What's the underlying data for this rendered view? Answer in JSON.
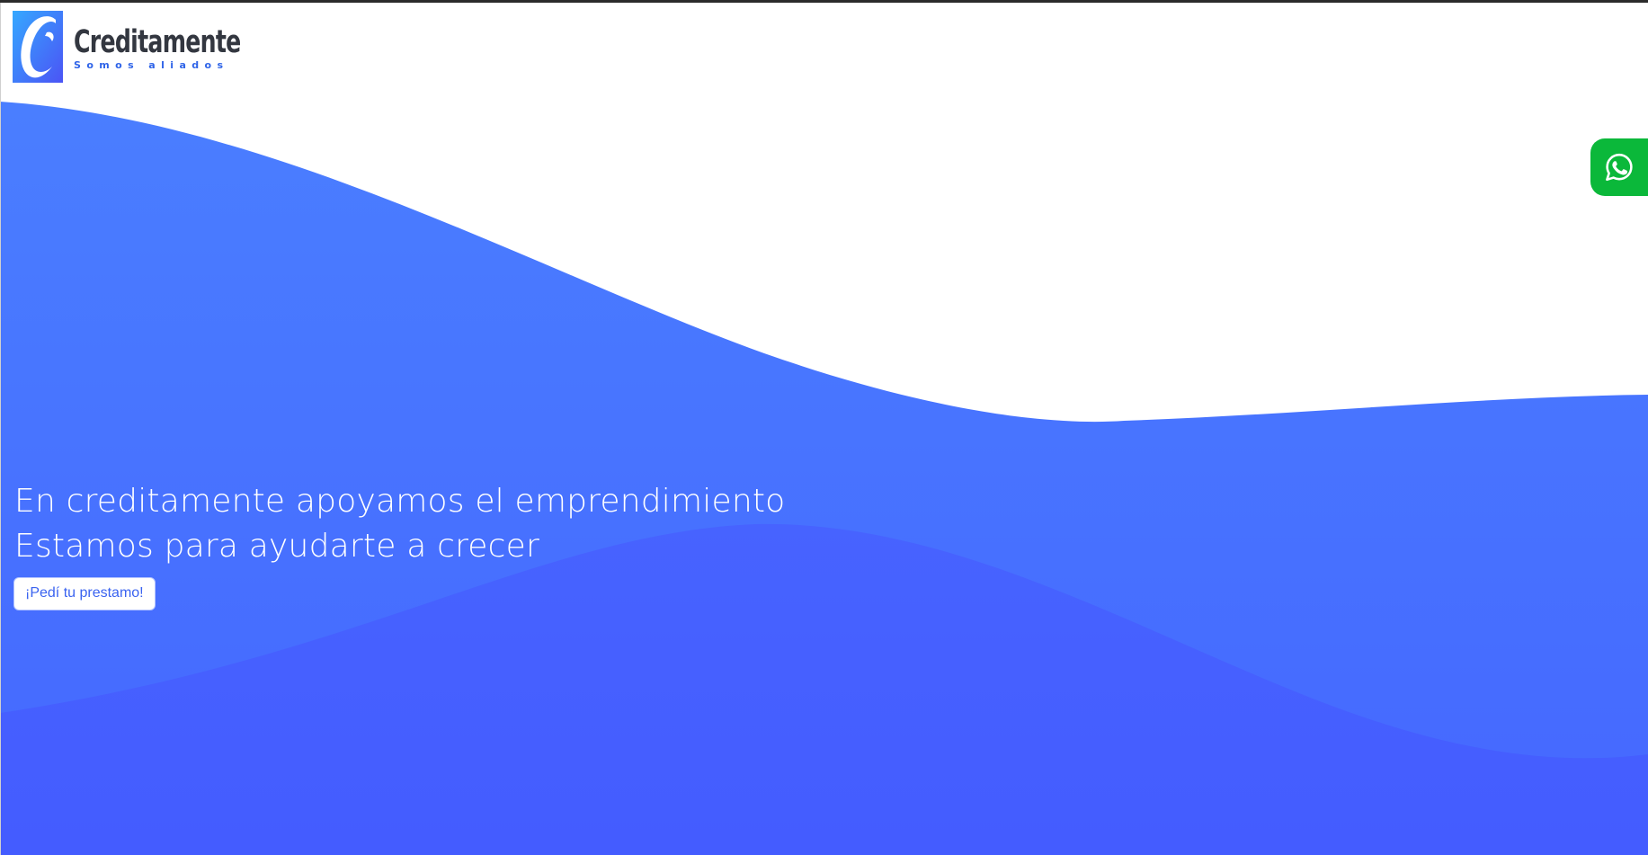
{
  "brand": {
    "name": "Creditamente",
    "tagline": "Somos aliados",
    "logo_icon": "creditamente-logo-icon"
  },
  "hero": {
    "line1": "En creditamente apoyamos el emprendimiento",
    "line2": "Estamos para ayudarte a crecer",
    "cta_label": "¡Pedí tu prestamo!"
  },
  "floating": {
    "whatsapp_icon": "whatsapp-icon"
  },
  "colors": {
    "wave_front": "#4779ff",
    "wave_back": "#465dff",
    "whatsapp": "#0bb83a",
    "tagline": "#2f64e8",
    "brand_text": "#333740"
  }
}
